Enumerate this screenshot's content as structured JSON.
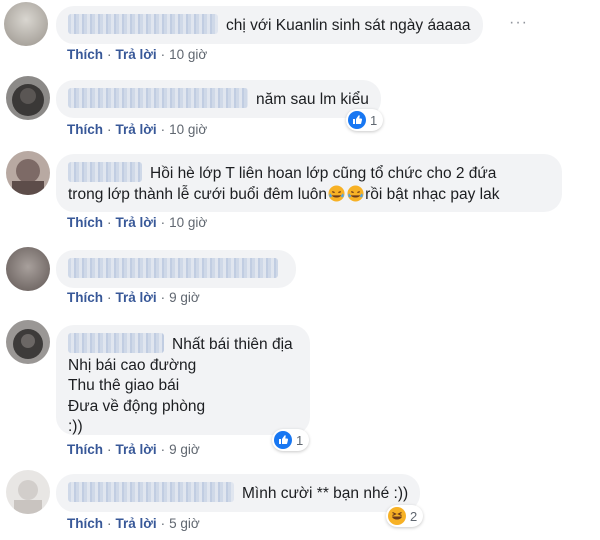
{
  "comments": [
    {
      "text_lines": [
        "chị với Kuanlin sinh sát ngày áaaaa"
      ],
      "like_label": "Thích",
      "reply_label": "Trả lời",
      "time": "10 giờ",
      "reaction": null,
      "more_icon": "more-dots-icon"
    },
    {
      "text_lines": [
        "năm sau lm kiểu"
      ],
      "like_label": "Thích",
      "reply_label": "Trả lời",
      "time": "10 giờ",
      "reaction": {
        "type": "like",
        "count": "1"
      }
    },
    {
      "text_lines": [
        "Hồi hè lớp T liên hoan lớp cũng tổ chức cho 2 đứa",
        "trong lớp thành lễ cưới buổi đêm luôn",
        "rồi bật nhạc pay lak"
      ],
      "like_label": "Thích",
      "reply_label": "Trả lời",
      "time": "10 giờ",
      "reaction": null
    },
    {
      "text_lines": [],
      "like_label": "Thích",
      "reply_label": "Trả lời",
      "time": "9 giờ",
      "reaction": null
    },
    {
      "text_lines": [
        "Nhất bái thiên địa",
        "Nhị bái cao đường",
        "Thu thê giao bái",
        "Đưa về động phòng",
        ":))"
      ],
      "like_label": "Thích",
      "reply_label": "Trả lời",
      "time": "9 giờ",
      "reaction": {
        "type": "like",
        "count": "1"
      }
    },
    {
      "text_lines": [
        "Mình cười ** bạn nhé :))"
      ],
      "like_label": "Thích",
      "reply_label": "Trả lời",
      "time": "5 giờ",
      "reaction": {
        "type": "haha",
        "count": "2"
      }
    }
  ],
  "separator": "·",
  "colors": {
    "link": "#385898",
    "bubble": "#f2f3f5",
    "like_blue": "#1877f2",
    "haha_yellow": "#f7b125"
  }
}
